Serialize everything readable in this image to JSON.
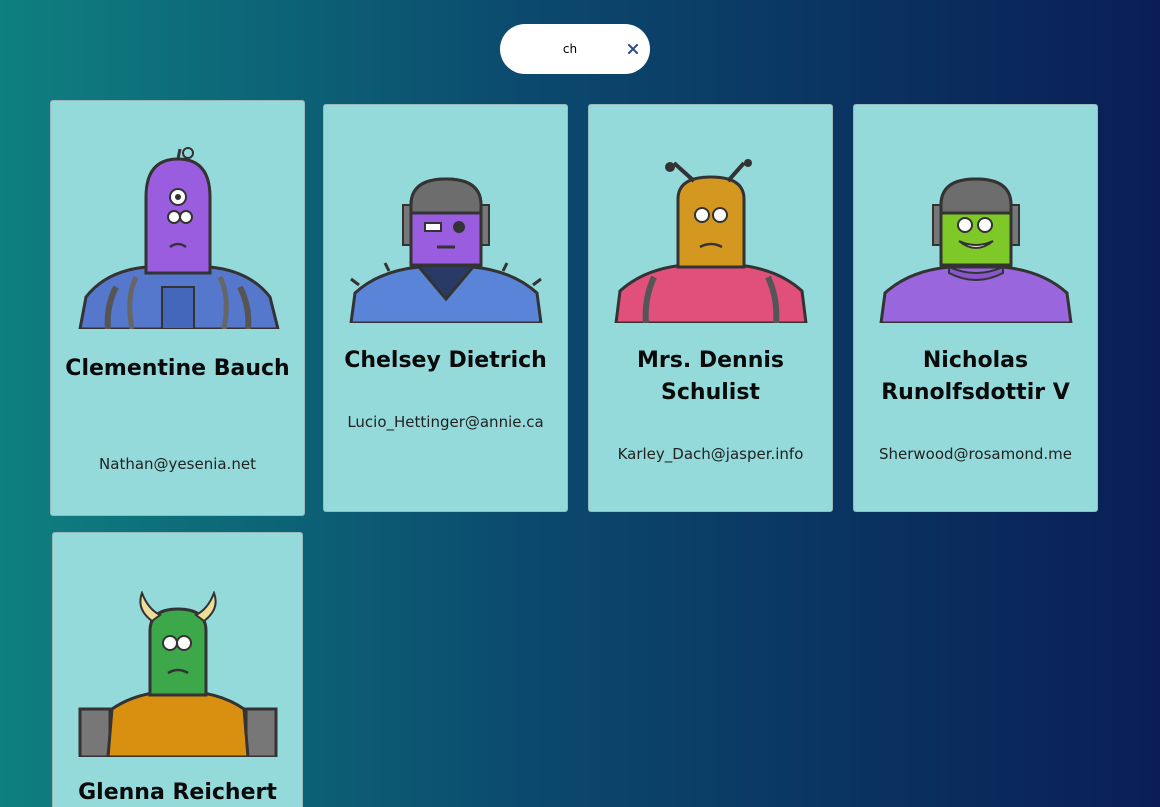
{
  "search": {
    "value": "ch",
    "clear_icon": "close-icon"
  },
  "robots": [
    {
      "name": "Clementine Bauch",
      "email": "Nathan@yesenia.net",
      "avatar": "purple-robot-one-antenna"
    },
    {
      "name": "Chelsey Dietrich",
      "email": "Lucio_Hettinger@annie.ca",
      "avatar": "purple-robot-helmet"
    },
    {
      "name": "Mrs. Dennis Schulist",
      "email": "Karley_Dach@jasper.info",
      "avatar": "orange-robot-two-antennae"
    },
    {
      "name": "Nicholas Runolfsdottir V",
      "email": "Sherwood@rosamond.me",
      "avatar": "green-robot-helmet"
    },
    {
      "name": "Glenna Reichert",
      "email": "",
      "avatar": "green-robot-horns"
    }
  ],
  "colors": {
    "card_bg": "#95dadb",
    "gradient_start": "#0e8080",
    "gradient_end": "#0a1e55"
  }
}
